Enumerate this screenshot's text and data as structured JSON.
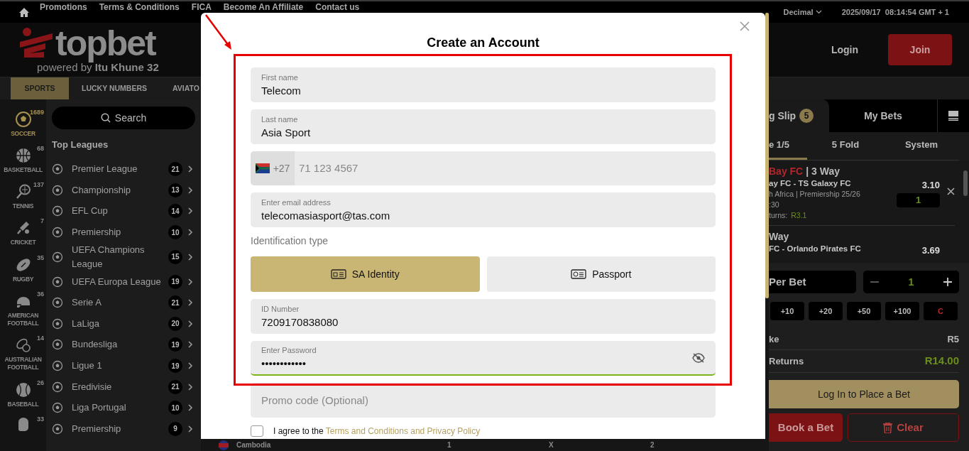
{
  "top_nav": {
    "links": [
      "Promotions",
      "Terms & Conditions",
      "FICA",
      "Become An Affiliate",
      "Contact us"
    ],
    "odds_format": "Decimal",
    "clock": "2025/09/17  08:14:54 GMT + 1"
  },
  "header": {
    "logo_text": "topbet",
    "tagline": "powered by **Itu Khune 32**",
    "login": "Login",
    "join": "Join"
  },
  "product_tabs": [
    {
      "label": "SPORTS",
      "selected": true
    },
    {
      "label": "LUCKY NUMBERS",
      "selected": false
    },
    {
      "label": "AVIATO",
      "selected": false
    }
  ],
  "sports": [
    {
      "label": "SOCCER",
      "count": "1689",
      "selected": true
    },
    {
      "label": "BASKETBALL",
      "count": "68",
      "selected": false
    },
    {
      "label": "TENNIS",
      "count": "137",
      "selected": false
    },
    {
      "label": "CRICKET",
      "count": "7",
      "selected": false
    },
    {
      "label": "RUGBY",
      "count": "35",
      "selected": false
    },
    {
      "label": "AMERICAN FOOTBALL",
      "count": "36",
      "selected": false
    },
    {
      "label": "AUSTRALIAN FOOTBALL",
      "count": "14",
      "selected": false
    },
    {
      "label": "BASEBALL",
      "count": "26",
      "selected": false
    },
    {
      "count": "33",
      "selected": false
    }
  ],
  "leagues_panel": {
    "search_label": "Search",
    "heading": "Top Leagues",
    "leagues": [
      {
        "name": "Premier League",
        "count": "21"
      },
      {
        "name": "Championship",
        "count": "13"
      },
      {
        "name": "EFL Cup",
        "count": "14"
      },
      {
        "name": "Premiership",
        "count": "10"
      },
      {
        "name": "UEFA Champions League",
        "count": "15"
      },
      {
        "name": "UEFA Europa League",
        "count": "19"
      },
      {
        "name": "Serie A",
        "count": "21"
      },
      {
        "name": "LaLiga",
        "count": "20"
      },
      {
        "name": "Bundesliga",
        "count": "19"
      },
      {
        "name": "Ligue 1",
        "count": "19"
      },
      {
        "name": "Eredivisie",
        "count": "21"
      },
      {
        "name": "Liga Portugal",
        "count": "10"
      },
      {
        "name": "Premiership",
        "count": "9"
      }
    ]
  },
  "event_row": {
    "team": "Cambodia",
    "outcomes": [
      "1",
      "X",
      "2"
    ]
  },
  "modal": {
    "title": "Create an Account",
    "fields": [
      {
        "kind": "text",
        "label": "First name",
        "value": "Telecom"
      },
      {
        "kind": "text",
        "label": "Last name",
        "value": "Asia Sport"
      },
      {
        "kind": "phone",
        "dial_code": "+27",
        "placeholder": "71 123 4567"
      },
      {
        "kind": "text",
        "label": "Enter email address",
        "value": "telecomasiasport@tas.com"
      },
      {
        "kind": "choice",
        "label": "Identification type",
        "options": [
          {
            "label": "SA Identity",
            "selected": true
          },
          {
            "label": "Passport",
            "selected": false
          }
        ]
      },
      {
        "kind": "text",
        "label": "ID Number",
        "value": "7209170838080"
      },
      {
        "kind": "password",
        "label": "Enter Password",
        "value": "••••••••••••",
        "focused": true
      },
      {
        "kind": "text",
        "placeholder": "Promo code (Optional)"
      }
    ],
    "agreement": {
      "text": "I agree to the",
      "link": "Terms and Conditions and Privacy Policy",
      "checked": false
    }
  },
  "bet_slip": {
    "tabs": [
      {
        "label": "g Slip",
        "count": "5",
        "selected": true
      },
      {
        "label": "My Bets",
        "selected": false
      }
    ],
    "bet_types": [
      {
        "label": "e 1/5",
        "selected": true
      },
      {
        "label": "5 Fold",
        "selected": false
      },
      {
        "label": "System",
        "selected": false
      }
    ],
    "bets": [
      {
        "team": "Bay FC",
        "market": "| 3 Way",
        "match": "ay FC - TS Galaxy FC",
        "competition": "h Africa | Premiership 25/26",
        "time": ":30",
        "odds": "3.10",
        "stake": "1",
        "returns_label": "turns:",
        "returns": "R3.1"
      },
      {
        "market": "Way",
        "match": "FC - Orlando Pirates FC",
        "odds": "3.69"
      }
    ],
    "per_bet_label": "Per Bet",
    "stake_value": "1",
    "quick_stakes": [
      {
        "label": "+10",
        "kind": "add"
      },
      {
        "label": "+20",
        "kind": "add"
      },
      {
        "label": "+50",
        "kind": "add"
      },
      {
        "label": "+100",
        "kind": "add"
      },
      {
        "label": "C",
        "kind": "clear"
      }
    ],
    "summary": [
      {
        "label": "ke",
        "value": "R5",
        "kind": "plain"
      },
      {
        "label": "Returns",
        "value": "R14.00",
        "kind": "highlight"
      }
    ],
    "login_button": "Log In to Place a Bet",
    "book_button": "Book a Bet",
    "clear_button": "Clear"
  }
}
